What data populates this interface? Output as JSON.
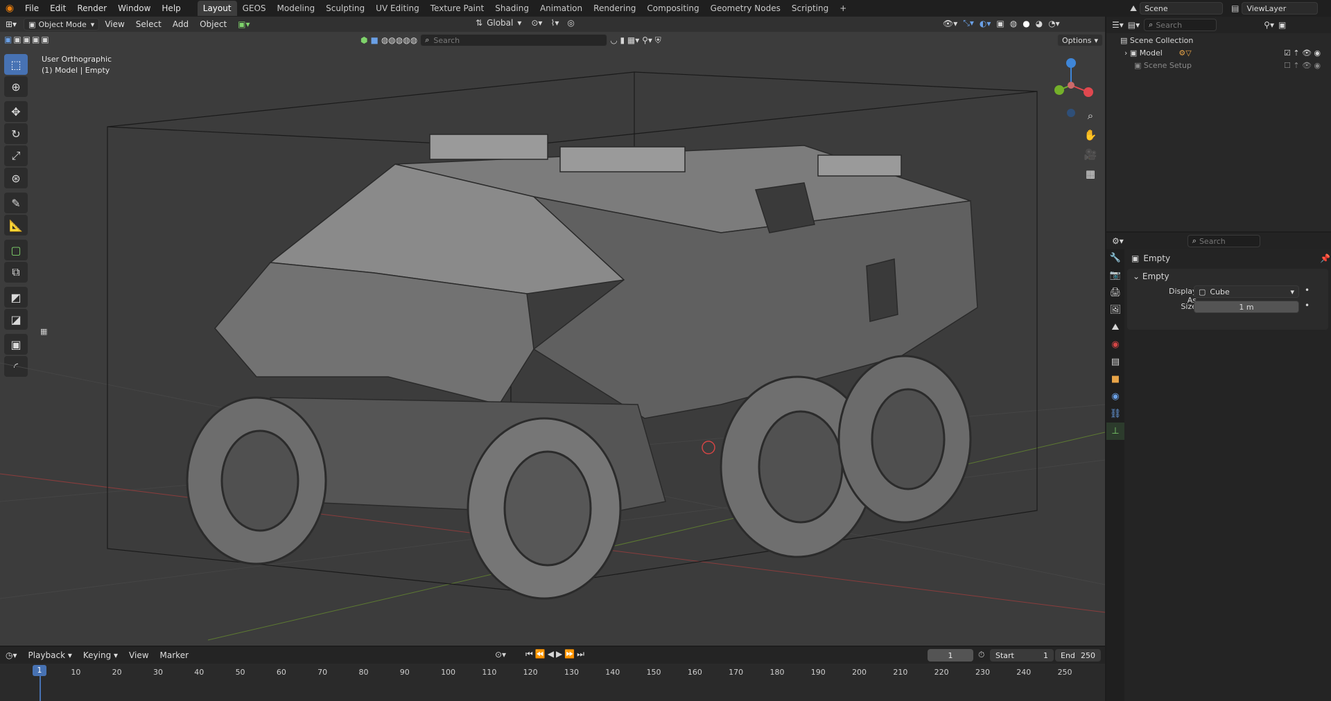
{
  "topbar": {
    "menus": [
      "File",
      "Edit",
      "Render",
      "Window",
      "Help"
    ],
    "workspaces": [
      "Layout",
      "GEOS",
      "Modeling",
      "Sculpting",
      "UV Editing",
      "Texture Paint",
      "Shading",
      "Animation",
      "Rendering",
      "Compositing",
      "Geometry Nodes",
      "Scripting"
    ],
    "active_workspace": "Layout",
    "add_workspace": "+",
    "scene_name": "Scene",
    "view_layer": "ViewLayer"
  },
  "viewport": {
    "mode": "Object Mode",
    "menus": [
      "View",
      "Select",
      "Add",
      "Object"
    ],
    "transform_orientation": "Global",
    "search_placeholder": "Search",
    "options_label": "Options",
    "info_line1": "User Orthographic",
    "info_line2": "(1) Model | Empty"
  },
  "outliner": {
    "search_placeholder": "Search",
    "root": "Scene Collection",
    "items": [
      "Model",
      "Scene Setup"
    ]
  },
  "properties": {
    "search_placeholder": "Search",
    "object_name": "Empty",
    "panel_title": "Empty",
    "display_as_label": "Display As",
    "display_as_value": "Cube",
    "size_label": "Size",
    "size_value": "1 m"
  },
  "timeline": {
    "menus": [
      "Playback",
      "Keying",
      "View",
      "Marker"
    ],
    "current_frame": "1",
    "start_label": "Start",
    "start_value": "1",
    "end_label": "End",
    "end_value": "250",
    "ticks": [
      "1",
      "10",
      "20",
      "30",
      "40",
      "50",
      "60",
      "70",
      "80",
      "90",
      "100",
      "110",
      "120",
      "130",
      "140",
      "150",
      "160",
      "170",
      "180",
      "190",
      "200",
      "210",
      "220",
      "230",
      "240",
      "250"
    ]
  },
  "colors": {
    "accent": "#4772b3",
    "axis_x": "#e0484f",
    "axis_y": "#74b02a",
    "axis_z": "#3f86d8"
  }
}
